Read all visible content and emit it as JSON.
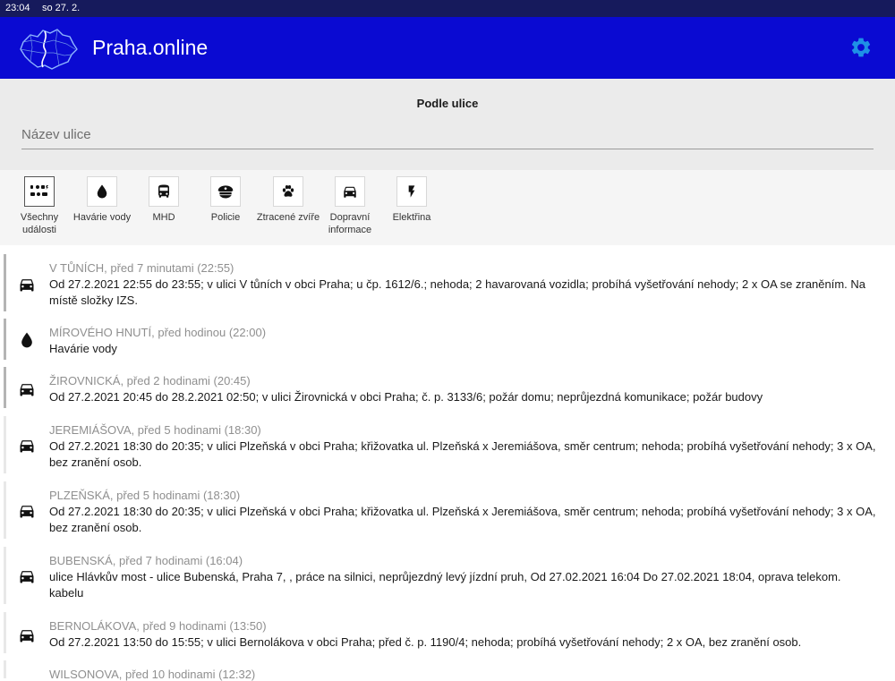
{
  "status": {
    "time": "23:04",
    "date": "so 27. 2."
  },
  "header": {
    "title": "Praha.online",
    "settings_icon": "gear-icon",
    "accent": "#1e90e6",
    "bg": "#0a0ad2"
  },
  "search": {
    "label": "Podle ulice",
    "placeholder": "Název ulice",
    "value": ""
  },
  "filters": [
    {
      "label": "Všechny události",
      "icon": "all-events-icon"
    },
    {
      "label": "Havárie vody",
      "icon": "water-drop-icon"
    },
    {
      "label": "MHD",
      "icon": "bus-icon"
    },
    {
      "label": "Policie",
      "icon": "police-cap-icon"
    },
    {
      "label": "Ztracené zvíře",
      "icon": "paw-icon"
    },
    {
      "label": "Dopravní informace",
      "icon": "car-icon"
    },
    {
      "label": "Elektřina",
      "icon": "lightning-icon"
    }
  ],
  "events": [
    {
      "icon": "car-icon",
      "header": "V TŮNÍCH, před 7 minutami (22:55)",
      "text": "Od 27.2.2021 22:55 do 23:55; v ulici V tůních v obci Praha; u čp. 1612/6.; nehoda; 2 havarovaná vozidla; probíhá vyšetřování nehody; 2 x OA se zraněním. Na místě složky IZS."
    },
    {
      "icon": "water-drop-icon",
      "header": "MÍROVÉHO HNUTÍ, před hodinou (22:00)",
      "text": "Havárie vody"
    },
    {
      "icon": "car-icon",
      "header": "ŽIROVNICKÁ, před 2 hodinami (20:45)",
      "text": "Od 27.2.2021 20:45 do 28.2.2021 02:50; v ulici Žirovnická v obci Praha; č. p. 3133/6; požár domu; neprůjezdná komunikace; požár budovy"
    },
    {
      "icon": "car-icon",
      "header": "JEREMIÁŠOVA, před 5 hodinami (18:30)",
      "text": "Od 27.2.2021 18:30 do 20:35; v ulici Plzeňská v obci Praha; křižovatka ul. Plzeňská x Jeremiášova, směr centrum; nehoda; probíhá vyšetřování nehody; 3 x OA, bez zranění osob."
    },
    {
      "icon": "car-icon",
      "header": "PLZEŇSKÁ, před 5 hodinami (18:30)",
      "text": "Od 27.2.2021 18:30 do 20:35; v ulici Plzeňská v obci Praha; křižovatka ul. Plzeňská x Jeremiášova, směr centrum; nehoda; probíhá vyšetřování nehody; 3 x OA, bez zranění osob."
    },
    {
      "icon": "car-icon",
      "header": "BUBENSKÁ, před 7 hodinami (16:04)",
      "text": "ulice Hlávkův most - ulice Bubenská, Praha 7, , práce na silnici, neprůjezdný levý jízdní pruh, Od 27.02.2021 16:04 Do 27.02.2021 18:04, oprava telekom. kabelu"
    },
    {
      "icon": "car-icon",
      "header": "BERNOLÁKOVA, před 9 hodinami (13:50)",
      "text": "Od 27.2.2021 13:50 do 15:55; v ulici Bernolákova v obci Praha; před č. p. 1190/4; nehoda; probíhá vyšetřování nehody; 2 x OA, bez zranění osob."
    },
    {
      "icon": "car-icon",
      "header": "WILSONOVA, před 10 hodinami (12:32)",
      "text": ""
    }
  ]
}
